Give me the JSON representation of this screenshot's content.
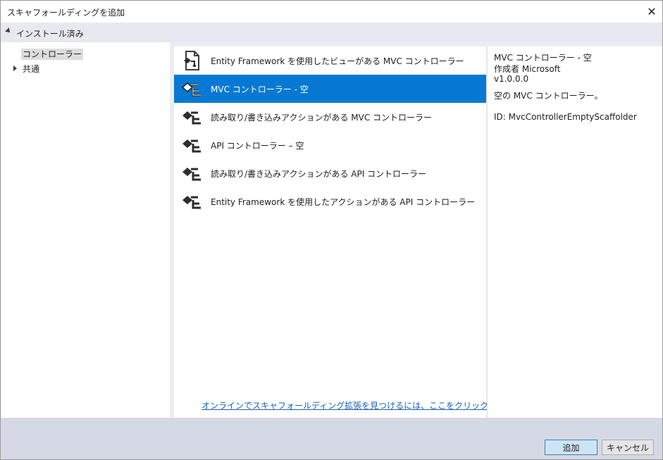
{
  "window": {
    "title": "スキャフォールディングを追加",
    "close_glyph": "✕"
  },
  "installed": {
    "label": "インストール済み"
  },
  "tree": {
    "items": [
      {
        "label": "コントローラー",
        "selected": true
      },
      {
        "label": "共通",
        "selected": false
      }
    ]
  },
  "list": {
    "items": [
      {
        "label": "Entity Framework を使用したビューがある MVC コントローラー",
        "icon": "entity-framework-controller-icon"
      },
      {
        "label": "MVC コントローラー - 空",
        "icon": "controller-icon",
        "selected": true
      },
      {
        "label": "読み取り/書き込みアクションがある MVC コントローラー",
        "icon": "controller-icon"
      },
      {
        "label": "API コントローラー – 空",
        "icon": "controller-icon"
      },
      {
        "label": "読み取り/書き込みアクションがある API コントローラー",
        "icon": "controller-icon"
      },
      {
        "label": "Entity Framework を使用したアクションがある API コントローラー",
        "icon": "controller-icon"
      }
    ],
    "online_link": "オンラインでスキャフォールディング拡張を見つけるには、ここをクリックしてください。"
  },
  "details": {
    "title": "MVC コントローラー - 空",
    "author": "作成者 Microsoft",
    "version": "v1.0.0.0",
    "description": "空の MVC コントローラー。",
    "id": "ID: MvcControllerEmptyScaffolder"
  },
  "footer": {
    "add_label": "追加",
    "cancel_label": "キャンセル"
  },
  "colors": {
    "selection": "#0879d3",
    "link": "#1a5fb4",
    "footer": "#d5d9e5"
  }
}
